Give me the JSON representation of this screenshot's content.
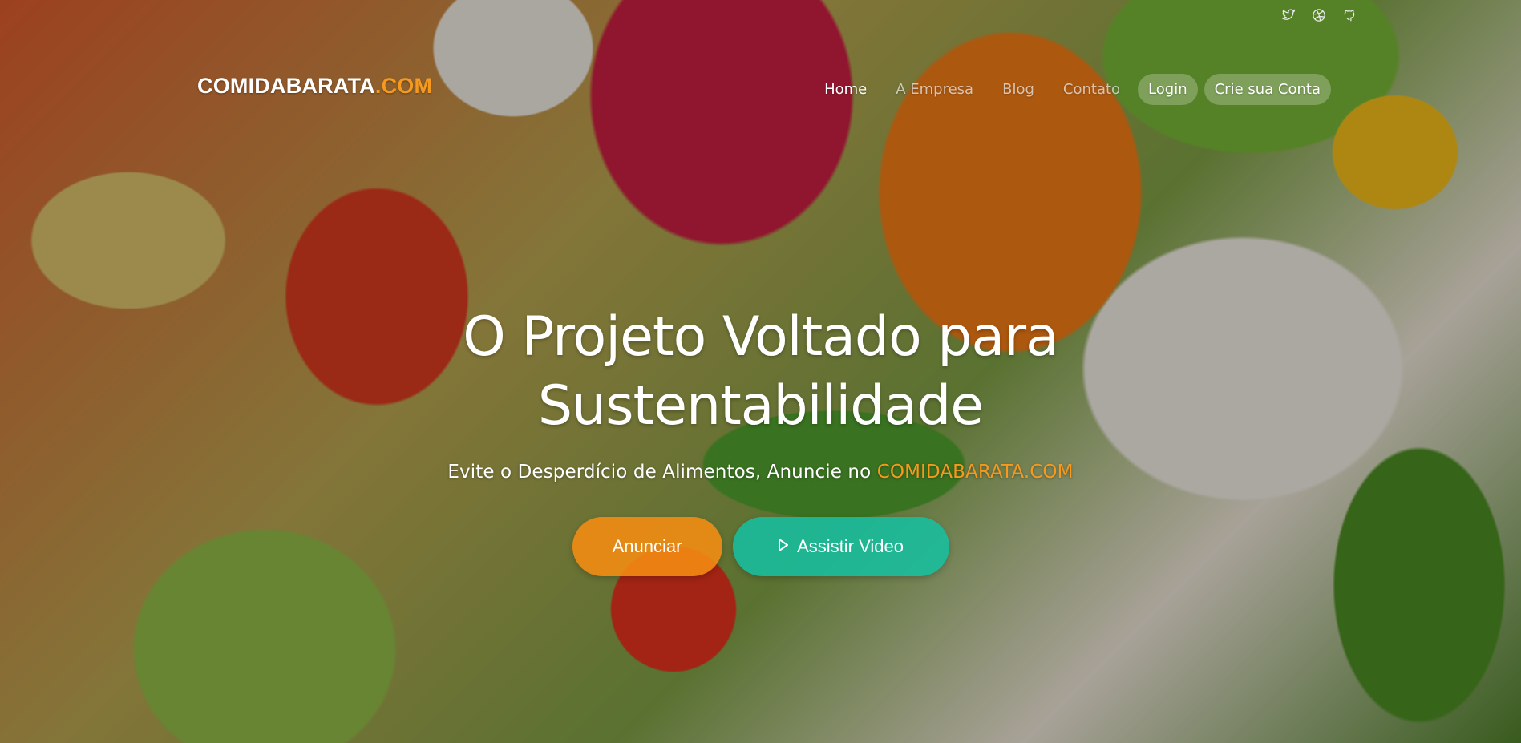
{
  "background": {
    "image_subject": "fresh vegetables"
  },
  "social": [
    {
      "icon": "twitter-icon"
    },
    {
      "icon": "dribbble-icon"
    },
    {
      "icon": "github-icon"
    }
  ],
  "brand": {
    "name": "COMIDABARATA",
    "suffix": ".COM"
  },
  "nav": {
    "items": [
      {
        "label": "Home"
      },
      {
        "label": "A Empresa"
      },
      {
        "label": "Blog"
      },
      {
        "label": "Contato"
      }
    ],
    "login_label": "Login",
    "signup_label": "Crie sua Conta"
  },
  "hero": {
    "title_line1": "O Projeto Voltado para",
    "title_line2": "Sustentabilidade",
    "subtitle_text": "Evite o Desperdício de Alimentos, Anuncie no ",
    "subtitle_highlight": "COMIDABARATA.COM",
    "primary_button": "Anunciar",
    "secondary_button": "Assistir Video"
  },
  "colors": {
    "accent": "#f59a1e",
    "primary_button": "#f58c12",
    "secondary_button": "#1abc9c"
  }
}
